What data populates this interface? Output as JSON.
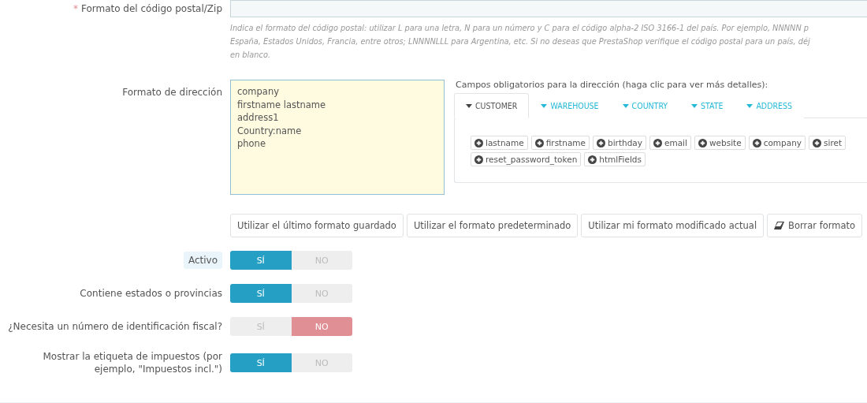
{
  "zip_format": {
    "label": "Formato del código postal/Zip",
    "required_mark": "*",
    "help": [
      "Indica el formato del código postal: utilizar L para una letra, N para un número y C para el código alpha-2 ISO 3166-1 del país. Por ejemplo, NNNNN p",
      "España, Estados Unidos, Francia, entre otros; LNNNNLLL para Argentina, etc. Si no deseas que PrestaShop verifique el código postal para un país, déj",
      "en blanco."
    ]
  },
  "address_format": {
    "label": "Formato de dirección",
    "lines": [
      "company",
      "firstname lastname",
      "address1",
      "Country:name",
      "phone"
    ],
    "fields_title": "Campos obligatorios para la dirección (haga clic para ver más detalles):",
    "tabs": [
      {
        "label": "CUSTOMER",
        "selected": true
      },
      {
        "label": "WAREHOUSE",
        "selected": false
      },
      {
        "label": "COUNTRY",
        "selected": false
      },
      {
        "label": "STATE",
        "selected": false
      },
      {
        "label": "ADDRESS",
        "selected": false
      }
    ],
    "chips": [
      "lastname",
      "firstname",
      "birthday",
      "email",
      "website",
      "company",
      "siret",
      "reset_password_token",
      "htmlFields"
    ],
    "buttons": [
      {
        "label": "Utilizar el último formato guardado",
        "kind": "text"
      },
      {
        "label": "Utilizar el formato predeterminado",
        "kind": "text"
      },
      {
        "label": "Utilizar mi formato modificado actual",
        "kind": "text"
      },
      {
        "label": "Borrar formato",
        "kind": "eraser"
      }
    ]
  },
  "switches": [
    {
      "label": "Activo",
      "highlighted": true,
      "yes": "SÍ",
      "no": "NO",
      "on": true
    },
    {
      "label": "Contiene estados o provincias",
      "highlighted": false,
      "yes": "SÍ",
      "no": "NO",
      "on": true
    },
    {
      "label": "¿Necesita un número de identificación fiscal?",
      "highlighted": false,
      "yes": "SÍ",
      "no": "NO",
      "on": false
    },
    {
      "label": "Mostrar la etiqueta de impuestos (por ejemplo, \"Impuestos incl.\")",
      "highlighted": false,
      "yes": "SÍ",
      "no": "NO",
      "on": true
    }
  ]
}
